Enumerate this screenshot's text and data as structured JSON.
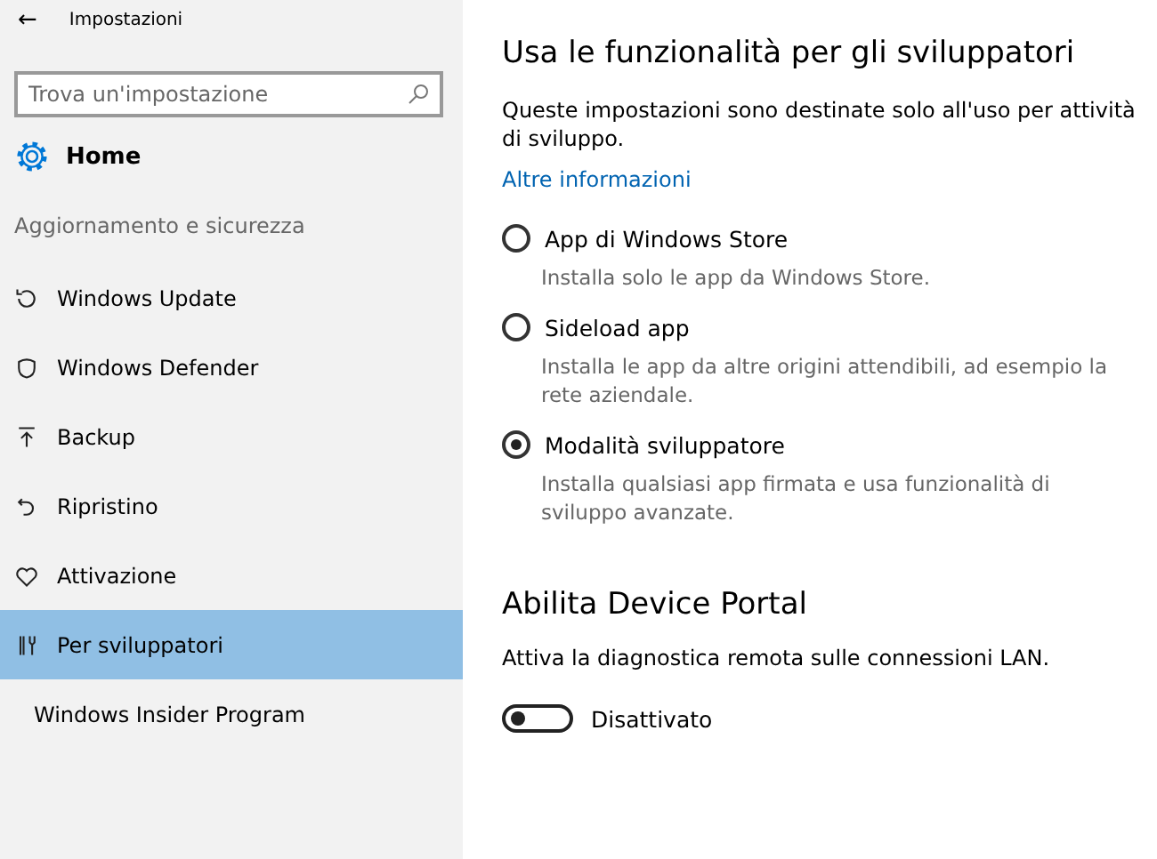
{
  "window": {
    "title": "Impostazioni",
    "back": "←"
  },
  "sidebar": {
    "search": {
      "placeholder": "Trova un'impostazione"
    },
    "home": "Home",
    "section": "Aggiornamento e sicurezza",
    "items": [
      {
        "label": "Windows Update",
        "selected": false
      },
      {
        "label": "Windows Defender",
        "selected": false
      },
      {
        "label": "Backup",
        "selected": false
      },
      {
        "label": "Ripristino",
        "selected": false
      },
      {
        "label": "Attivazione",
        "selected": false
      },
      {
        "label": "Per sviluppatori",
        "selected": true
      },
      {
        "label": "Windows Insider Program",
        "selected": false
      }
    ]
  },
  "content": {
    "heading": "Usa le funzionalità per gli sviluppatori",
    "description": "Queste impostazioni sono destinate solo all'uso per attività di sviluppo.",
    "link": "Altre informazioni",
    "options": [
      {
        "label": "App di Windows Store",
        "description": "Installa solo le app da Windows Store.",
        "selected": false
      },
      {
        "label": "Sideload app",
        "description": "Installa le app da altre origini attendibili, ad esempio la rete aziendale.",
        "selected": false
      },
      {
        "label": "Modalità sviluppatore",
        "description": "Installa qualsiasi app firmata e usa funzionalità di sviluppo avanzate.",
        "selected": true
      }
    ],
    "portal": {
      "heading": "Abilita Device Portal",
      "description": "Attiva la diagnostica remota sulle connessioni LAN.",
      "toggle": {
        "on": false,
        "label": "Disattivato"
      }
    }
  }
}
